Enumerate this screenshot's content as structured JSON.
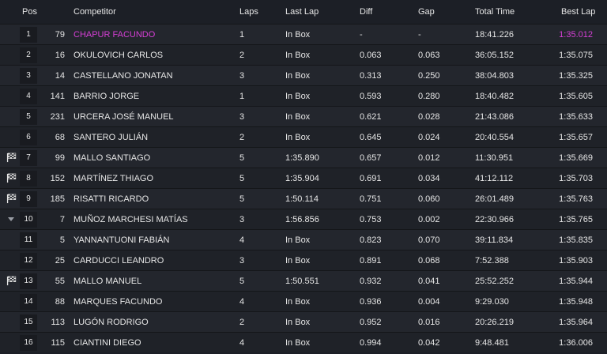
{
  "headers": {
    "pos": "Pos",
    "competitor": "Competitor",
    "laps": "Laps",
    "last_lap": "Last Lap",
    "diff": "Diff",
    "gap": "Gap",
    "total_time": "Total Time",
    "best_lap": "Best Lap"
  },
  "colors": {
    "highlight": "#d63fd6",
    "row_odd": "#23262d",
    "row_even": "#1f2228"
  },
  "rows": [
    {
      "indicator": "none",
      "pos": "1",
      "num": "79",
      "competitor": "CHAPUR FACUNDO",
      "laps": "1",
      "last_lap": "In Box",
      "diff": "-",
      "gap": "-",
      "total": "18:41.226",
      "best": "1:35.012",
      "highlight": true
    },
    {
      "indicator": "none",
      "pos": "2",
      "num": "16",
      "competitor": "OKULOVICH CARLOS",
      "laps": "2",
      "last_lap": "In Box",
      "diff": "0.063",
      "gap": "0.063",
      "total": "36:05.152",
      "best": "1:35.075"
    },
    {
      "indicator": "none",
      "pos": "3",
      "num": "14",
      "competitor": "CASTELLANO JONATAN",
      "laps": "3",
      "last_lap": "In Box",
      "diff": "0.313",
      "gap": "0.250",
      "total": "38:04.803",
      "best": "1:35.325"
    },
    {
      "indicator": "none",
      "pos": "4",
      "num": "141",
      "competitor": "BARRIO JORGE",
      "laps": "1",
      "last_lap": "In Box",
      "diff": "0.593",
      "gap": "0.280",
      "total": "18:40.482",
      "best": "1:35.605"
    },
    {
      "indicator": "none",
      "pos": "5",
      "num": "231",
      "competitor": "URCERA JOSÉ MANUEL",
      "laps": "3",
      "last_lap": "In Box",
      "diff": "0.621",
      "gap": "0.028",
      "total": "21:43.086",
      "best": "1:35.633"
    },
    {
      "indicator": "none",
      "pos": "6",
      "num": "68",
      "competitor": "SANTERO JULIÁN",
      "laps": "2",
      "last_lap": "In Box",
      "diff": "0.645",
      "gap": "0.024",
      "total": "20:40.554",
      "best": "1:35.657"
    },
    {
      "indicator": "flag",
      "pos": "7",
      "num": "99",
      "competitor": "MALLO SANTIAGO",
      "laps": "5",
      "last_lap": "1:35.890",
      "diff": "0.657",
      "gap": "0.012",
      "total": "11:30.951",
      "best": "1:35.669"
    },
    {
      "indicator": "flag",
      "pos": "8",
      "num": "152",
      "competitor": "MARTÍNEZ THIAGO",
      "laps": "5",
      "last_lap": "1:35.904",
      "diff": "0.691",
      "gap": "0.034",
      "total": "41:12.112",
      "best": "1:35.703"
    },
    {
      "indicator": "flag",
      "pos": "9",
      "num": "185",
      "competitor": "RISATTI RICARDO",
      "laps": "5",
      "last_lap": "1:50.114",
      "diff": "0.751",
      "gap": "0.060",
      "total": "26:01.489",
      "best": "1:35.763"
    },
    {
      "indicator": "down",
      "pos": "10",
      "num": "7",
      "competitor": "MUÑOZ MARCHESI MATÍAS",
      "laps": "3",
      "last_lap": "1:56.856",
      "diff": "0.753",
      "gap": "0.002",
      "total": "22:30.966",
      "best": "1:35.765"
    },
    {
      "indicator": "none",
      "pos": "11",
      "num": "5",
      "competitor": "YANNANTUONI FABIÁN",
      "laps": "4",
      "last_lap": "In Box",
      "diff": "0.823",
      "gap": "0.070",
      "total": "39:11.834",
      "best": "1:35.835"
    },
    {
      "indicator": "none",
      "pos": "12",
      "num": "25",
      "competitor": "CARDUCCI LEANDRO",
      "laps": "3",
      "last_lap": "In Box",
      "diff": "0.891",
      "gap": "0.068",
      "total": "7:52.388",
      "best": "1:35.903"
    },
    {
      "indicator": "flag",
      "pos": "13",
      "num": "55",
      "competitor": "MALLO MANUEL",
      "laps": "5",
      "last_lap": "1:50.551",
      "diff": "0.932",
      "gap": "0.041",
      "total": "25:52.252",
      "best": "1:35.944"
    },
    {
      "indicator": "none",
      "pos": "14",
      "num": "88",
      "competitor": "MARQUES FACUNDO",
      "laps": "4",
      "last_lap": "In Box",
      "diff": "0.936",
      "gap": "0.004",
      "total": "9:29.030",
      "best": "1:35.948"
    },
    {
      "indicator": "none",
      "pos": "15",
      "num": "113",
      "competitor": "LUGÓN RODRIGO",
      "laps": "2",
      "last_lap": "In Box",
      "diff": "0.952",
      "gap": "0.016",
      "total": "20:26.219",
      "best": "1:35.964"
    },
    {
      "indicator": "none",
      "pos": "16",
      "num": "115",
      "competitor": "CIANTINI DIEGO",
      "laps": "4",
      "last_lap": "In Box",
      "diff": "0.994",
      "gap": "0.042",
      "total": "9:48.481",
      "best": "1:36.006"
    }
  ]
}
